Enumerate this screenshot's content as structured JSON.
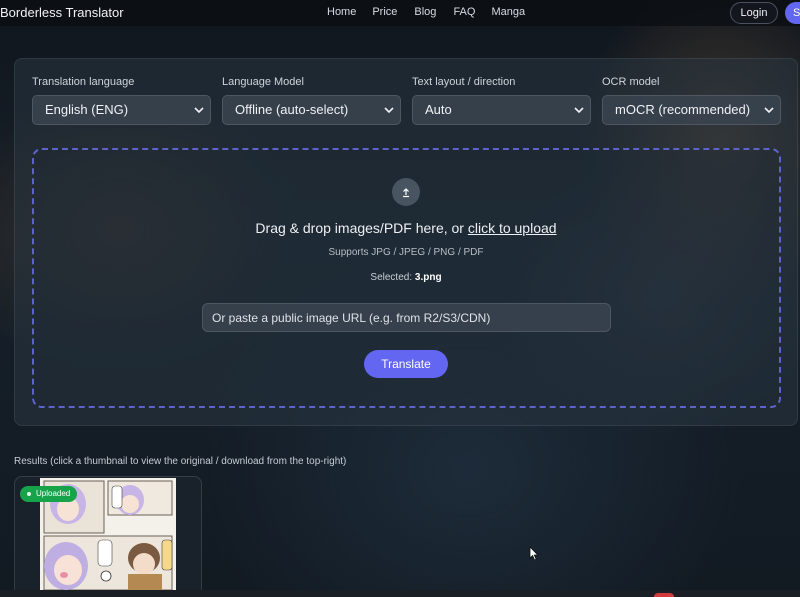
{
  "header": {
    "brand": "Borderless Translator",
    "nav": [
      "Home",
      "Price",
      "Blog",
      "FAQ",
      "Manga"
    ],
    "login_label": "Login",
    "signup_label": "S"
  },
  "settings": {
    "translation_language": {
      "label": "Translation language",
      "value": "English (ENG)"
    },
    "language_model": {
      "label": "Language Model",
      "value": "Offline (auto-select)"
    },
    "text_layout": {
      "label": "Text layout / direction",
      "value": "Auto"
    },
    "ocr_model": {
      "label": "OCR model",
      "value": "mOCR (recommended)"
    }
  },
  "upload": {
    "drop_text": "Drag & drop images/PDF here, or ",
    "upload_link": "click to upload",
    "supports": "Supports JPG / JPEG / PNG / PDF",
    "selected_prefix": "Selected: ",
    "selected_file": "3.png",
    "url_placeholder": "Or paste a public image URL (e.g. from R2/S3/CDN)",
    "translate_label": "Translate"
  },
  "results": {
    "label": "Results (click a thumbnail to view the original / download from the top-right)",
    "items": [
      {
        "status": "Uploaded"
      }
    ]
  },
  "colors": {
    "accent": "#6366f1",
    "success": "#17a34a"
  },
  "icons": [
    "upload-icon",
    "chevron-down-icon",
    "mouse-cursor-icon"
  ]
}
